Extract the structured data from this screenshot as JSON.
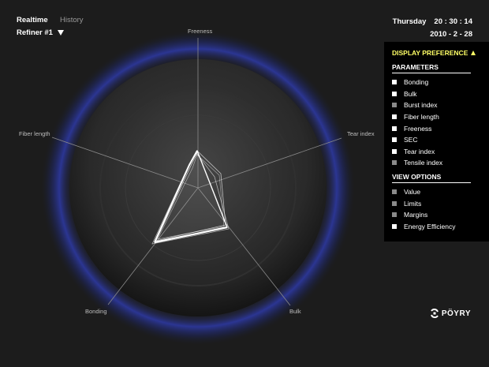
{
  "header": {
    "tabs": [
      {
        "label": "Realtime",
        "active": true
      },
      {
        "label": "History",
        "active": false
      }
    ],
    "refiner_label": "Refiner #1",
    "day": "Thursday",
    "time": "20 : 30 : 14",
    "date": "2010 - 2 - 28"
  },
  "radar": {
    "axes": [
      "Freeness",
      "Tear index",
      "Bulk",
      "Bonding",
      "Fiber length"
    ],
    "glow_color": "#3a48c8",
    "line_color": "#ffffff"
  },
  "panel": {
    "title": "DISPLAY PREFERENCE",
    "parameters_title": "PARAMETERS",
    "parameters": [
      {
        "label": "Bonding",
        "checked": true
      },
      {
        "label": "Bulk",
        "checked": true
      },
      {
        "label": "Burst index",
        "checked": false
      },
      {
        "label": "Fiber length",
        "checked": true
      },
      {
        "label": "Freeness",
        "checked": true
      },
      {
        "label": "SEC",
        "checked": true
      },
      {
        "label": "Tear index",
        "checked": true
      },
      {
        "label": "Tensile index",
        "checked": false
      }
    ],
    "view_title": "VIEW OPTIONS",
    "view_options": [
      {
        "label": "Value",
        "checked": false
      },
      {
        "label": "Limits",
        "checked": false
      },
      {
        "label": "Margins",
        "checked": false
      },
      {
        "label": "Energy Efficiency",
        "checked": true
      }
    ],
    "accent_color": "#ffff66"
  },
  "brand": {
    "name": "PÖYRY"
  }
}
